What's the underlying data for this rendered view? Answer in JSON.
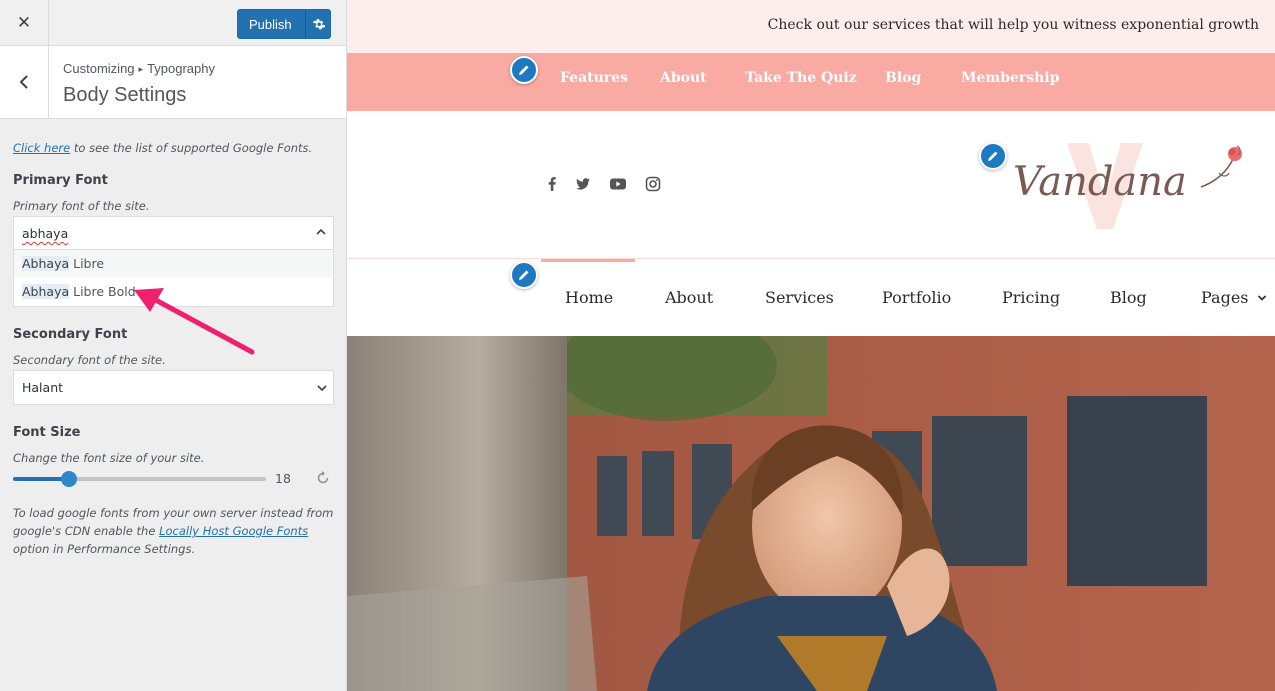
{
  "customizer": {
    "publish_label": "Publish",
    "breadcrumb_parent": "Customizing",
    "breadcrumb_sep": "▸",
    "breadcrumb_child": "Typography",
    "section_title": "Body Settings",
    "google_fonts_link": "Click here",
    "google_fonts_help": " to see the list of supported Google Fonts.",
    "primary_font": {
      "title": "Primary Font",
      "desc": "Primary font of the site.",
      "input_value": "abhaya",
      "options": [
        {
          "match": "Abhaya",
          "rest": " Libre"
        },
        {
          "match": "Abhaya",
          "rest": " Libre Bold"
        }
      ]
    },
    "secondary_font": {
      "title": "Secondary Font",
      "desc": "Secondary font of the site.",
      "value": "Halant"
    },
    "font_size": {
      "title": "Font Size",
      "desc": "Change the font size of your site.",
      "value": "18",
      "slider_fraction": 0.22
    },
    "note": {
      "before": "To load google fonts from your own server instead from google's CDN enable the ",
      "link": "Locally Host Google Fonts",
      "after": " option in Performance Settings."
    },
    "accent_color": "#2271b1",
    "arrow_color": "#f0206f"
  },
  "preview": {
    "announcement": "Check out our services that will help you witness exponential growth",
    "top_nav": [
      "Features",
      "About",
      "Take The Quiz",
      "Blog",
      "Membership"
    ],
    "social_icons": [
      "facebook-icon",
      "twitter-icon",
      "youtube-icon",
      "instagram-icon"
    ],
    "logo_text": "Vandana",
    "main_nav": [
      "Home",
      "About",
      "Services",
      "Portfolio",
      "Pricing",
      "Blog",
      "Pages"
    ],
    "colors": {
      "pink": "#f9aaa3",
      "announce_bg": "#fdeeec",
      "edit_blue": "#1d79c2"
    }
  }
}
